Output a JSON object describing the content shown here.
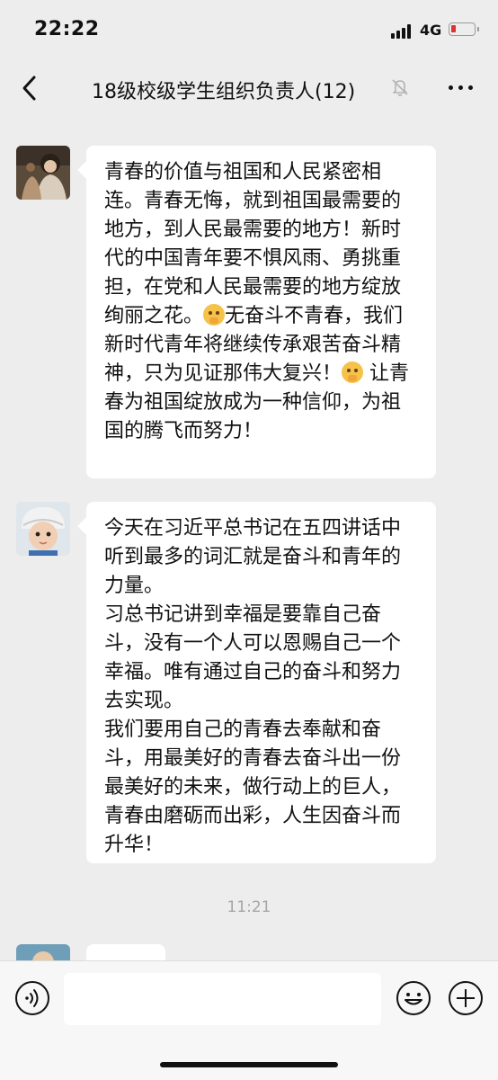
{
  "status_bar": {
    "time": "22:22",
    "network": "4G",
    "battery_level_fraction": 0.15,
    "icons": [
      "signal-icon",
      "battery-icon"
    ]
  },
  "nav": {
    "title": "18级校级学生组织负责人(12)",
    "icons": [
      "back-icon",
      "mute-bell-icon",
      "more-icon"
    ]
  },
  "messages": [
    {
      "sender_avatar": "avatar-woman-photo",
      "text": "青春的价值与祖国和人民紧密相连。青春无悔，就到祖国最需要的地方，到人民最需要的地方！新时代的中国青年要不惧风雨、勇挑重担，在党和人民最需要的地方绽放绚丽之花。",
      "text_2": "无奋斗不青春，我们新时代青年将继续传承艰苦奋斗精神，只为见证那伟大复兴！",
      "text_3": " 让青春为祖国绽放成为一种信仰，为祖国的腾飞而努力！",
      "emoji": "shushing-face-emoji"
    },
    {
      "sender_avatar": "avatar-child-photo",
      "text": "今天在习近平总书记在五四讲话中听到最多的词汇就是奋斗和青年的力量。\n习总书记讲到幸福是要靠自己奋斗，没有一个人可以恩赐自己一个幸福。唯有通过自己的奋斗和努力去实现。\n我们要用自己的青春去奉献和奋斗，用最美好的青春去奋斗出一份最美好的未来，做行动上的巨人，青春由磨砺而出彩，人生因奋斗而升华！"
    }
  ],
  "timestamp": "11:21",
  "input_bar": {
    "placeholder": "",
    "icons": [
      "voice-icon",
      "emoji-icon",
      "plus-icon"
    ]
  }
}
